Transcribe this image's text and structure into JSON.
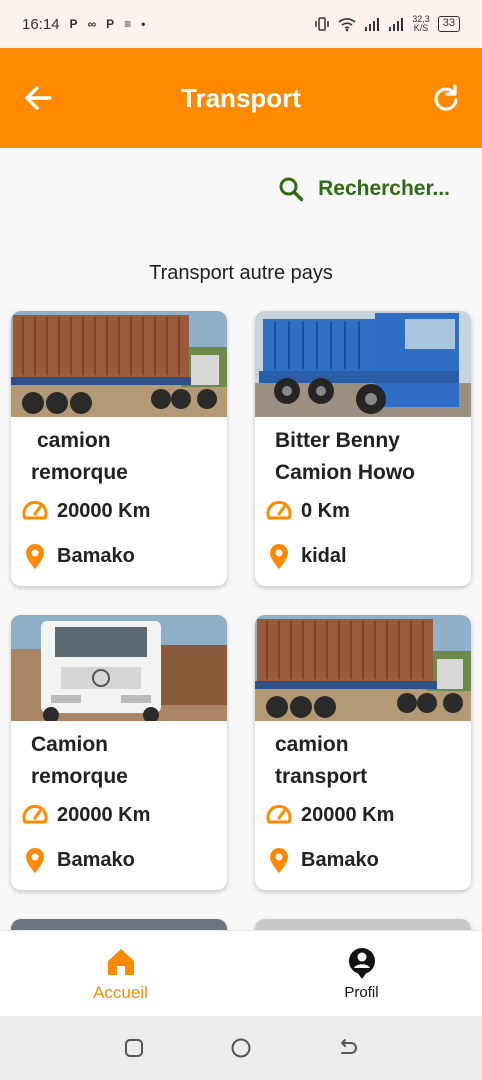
{
  "status_bar": {
    "time": "16:14",
    "notification_glyphs": [
      "P",
      "∞",
      "P",
      "≡",
      "•"
    ],
    "net_speed_value": "32,3",
    "net_speed_unit": "K/S",
    "battery": "33"
  },
  "app_bar": {
    "title": "Transport",
    "back_icon": "arrow-back-icon",
    "refresh_icon": "refresh-icon"
  },
  "search": {
    "label": "Rechercher..."
  },
  "section": {
    "title": "Transport autre pays"
  },
  "listings": [
    {
      "title_line1": "camion",
      "title_line2": "remorque",
      "distance": "20000 Km",
      "location": "Bamako",
      "image": "container-truck"
    },
    {
      "title_line1": "Bitter Benny",
      "title_line2": "Camion Howo",
      "distance": "0 Km",
      "location": "kidal",
      "image": "blue-dump-truck"
    },
    {
      "title_line1": "Camion",
      "title_line2": "remorque",
      "distance": "20000 Km",
      "location": "Bamako",
      "image": "white-mercedes-cab"
    },
    {
      "title_line1": "camion",
      "title_line2": "transport",
      "distance": "20000 Km",
      "location": "Bamako",
      "image": "container-truck"
    }
  ],
  "bottom_nav": {
    "home_label": "Accueil",
    "profile_label": "Profil"
  },
  "colors": {
    "accent": "#ff8a00",
    "search_green": "#2f6b12",
    "background": "#f8f8f8"
  }
}
